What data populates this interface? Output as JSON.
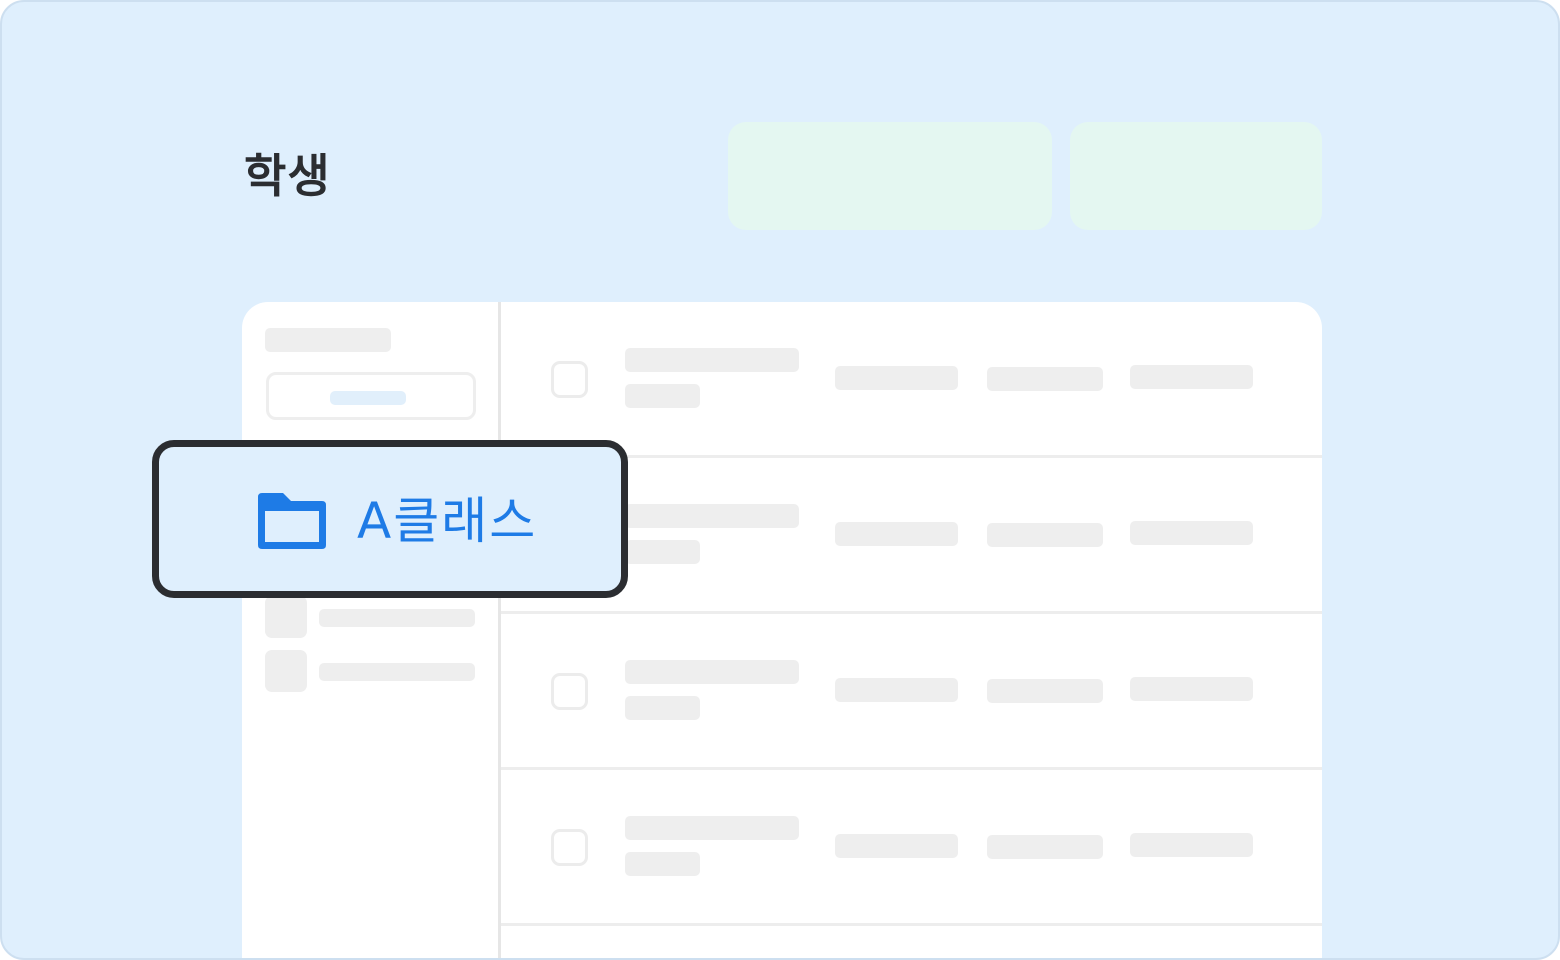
{
  "header": {
    "title": "학생"
  },
  "class_popup": {
    "icon": "folder-icon",
    "label": "A클래스"
  },
  "colors": {
    "background": "#dfeffd",
    "accent": "#1e7be6",
    "header_buttons": "#e4f7f1",
    "title_text": "#2b2d31",
    "placeholder": "#eeeeee"
  }
}
